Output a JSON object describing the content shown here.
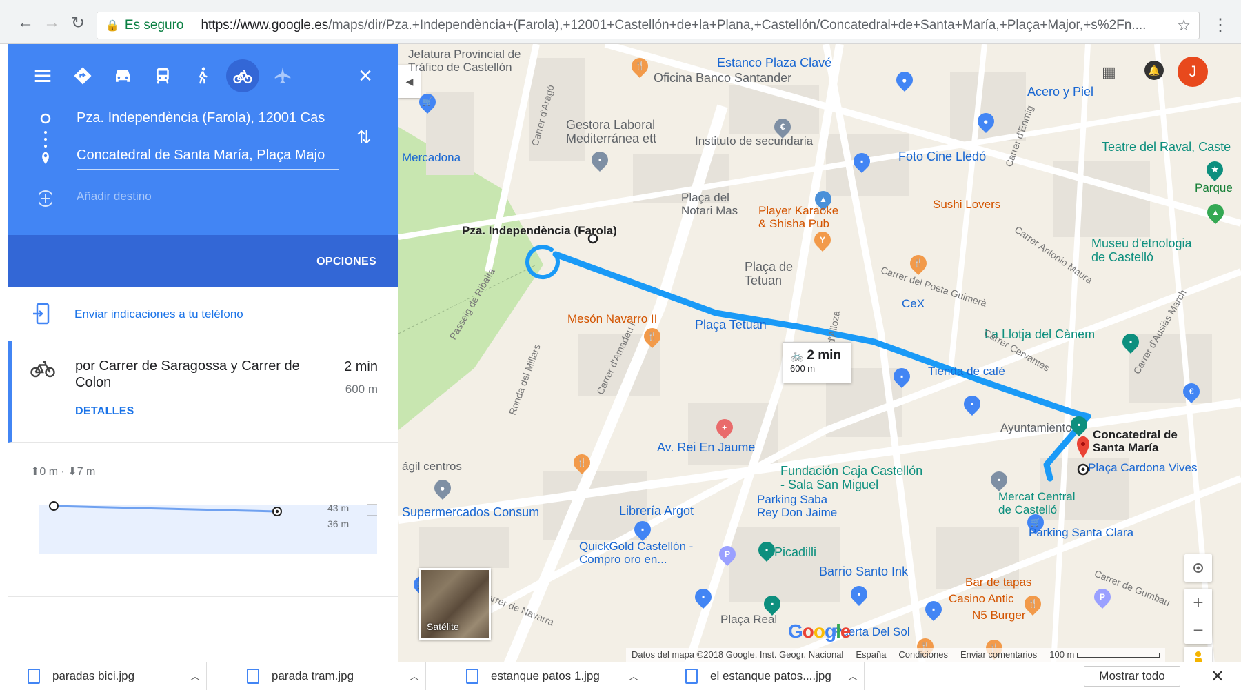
{
  "browser": {
    "secure_label": "Es seguro",
    "url_host": "https://www.google.es",
    "url_path": "/maps/dir/Pza.+Independència+(Farola),+12001+Castellón+de+la+Plana,+Castellón/Concatedral+de+Santa+María,+Plaça+Major,+s%2Fn...."
  },
  "directions": {
    "modes": [
      "menu",
      "best",
      "car",
      "transit",
      "walk",
      "bike",
      "flight"
    ],
    "active_mode": "bike",
    "origin": "Pza. Independència (Farola), 12001 Cas",
    "destination": "Concatedral de Santa María, Plaça Majo",
    "add_destination_placeholder": "Añadir destino",
    "options_label": "OPCIONES",
    "send_to_phone": "Enviar indicaciones a tu teléfono",
    "route": {
      "via": "por Carrer de Saragossa y Carrer de Colon",
      "time": "2 min",
      "distance": "600 m",
      "details_label": "DETALLES"
    },
    "elevation": {
      "summary": "⬆0 m · ⬇7 m",
      "max_label": "43 m",
      "min_label": "36 m"
    }
  },
  "map": {
    "avatar_letter": "J",
    "origin_label": "Pza. Independència (Farola)",
    "destination_label": "Concatedral de Santa María",
    "tooltip": {
      "time": "2 min",
      "distance": "600 m"
    },
    "satellite_label": "Satélite",
    "footer": {
      "attribution": "Datos del mapa ©2018 Google, Inst. Geogr. Nacional",
      "country": "España",
      "terms": "Condiciones",
      "feedback": "Enviar comentarios",
      "scale": "100 m"
    },
    "labels": [
      {
        "text": "Jefatura Provincial de Tráfico de Castellón",
        "display": "Jefatura Provincial de\nTráfico de Castellón",
        "cls": "poi-gray"
      },
      {
        "text": "Oficina Banco Santander",
        "cls": "poi-gray"
      },
      {
        "text": "Estanco Plaza Clavé",
        "cls": "poi-blue"
      },
      {
        "text": "Acero y Piel",
        "cls": "poi-blue"
      },
      {
        "text": "Gestora Laboral Mediterránea ett",
        "display": "Gestora Laboral\nMediterránea ett",
        "cls": "poi-gray"
      },
      {
        "text": "Instituto de secundaria",
        "cls": "poi-gray"
      },
      {
        "text": "Foto Cine Lledó",
        "cls": "poi-blue"
      },
      {
        "text": "Teatre del Raval, Caste",
        "cls": "poi-teal"
      },
      {
        "text": "Parque",
        "cls": "poi-green"
      },
      {
        "text": "Plaça del Notari Mas",
        "display": "Plaça del\nNotari Mas",
        "cls": "poi-gray"
      },
      {
        "text": "Player Karaoke & Shisha Pub",
        "display": "Player Karaoke\n& Shisha Pub",
        "cls": "poi-orange"
      },
      {
        "text": "Sushi Lovers",
        "cls": "poi-orange"
      },
      {
        "text": "Plaça de Tetuan",
        "display": "Plaça de\nTetuan",
        "cls": "poi-gray"
      },
      {
        "text": "Museu d'etnologia de Castelló",
        "display": "Museu d'etnologia\nde Castelló",
        "cls": "poi-teal"
      },
      {
        "text": "Mesón Navarro II",
        "cls": "poi-orange"
      },
      {
        "text": "Plaça Tetuan",
        "cls": "poi-blue"
      },
      {
        "text": "CeX",
        "cls": "poi-blue"
      },
      {
        "text": "La Llotja del Cànem",
        "cls": "poi-teal"
      },
      {
        "text": "Tienda de café",
        "cls": "poi-blue"
      },
      {
        "text": "Ayuntamiento",
        "cls": "poi-gray"
      },
      {
        "text": "Av. Rei En Jaume",
        "cls": "poi-blue"
      },
      {
        "text": "Fundación Caja Castellón - Sala San Miguel",
        "display": "Fundación Caja Castellón\n- Sala San Miguel",
        "cls": "poi-teal"
      },
      {
        "text": "Plaça Cardona Vives",
        "cls": "poi-blue"
      },
      {
        "text": "Mercat Central de Castelló",
        "display": "Mercat Central\nde Castelló",
        "cls": "poi-teal"
      },
      {
        "text": "Parking Santa Clara",
        "cls": "poi-blue"
      },
      {
        "text": "ágil centros",
        "cls": "poi-gray"
      },
      {
        "text": "Supermercados Consum",
        "cls": "poi-blue"
      },
      {
        "text": "Librería Argot",
        "cls": "poi-blue"
      },
      {
        "text": "Parking Saba Rey Don Jaime",
        "display": "Parking Saba\nRey Don Jaime",
        "cls": "poi-blue"
      },
      {
        "text": "QuickGold Castellón - Compro oro en...",
        "display": "QuickGold Castellón -\nCompro oro en...",
        "cls": "poi-blue"
      },
      {
        "text": "Picadilli",
        "cls": "poi-teal"
      },
      {
        "text": "Barrio Santo Ink",
        "cls": "poi-blue"
      },
      {
        "text": "Bar de tapas",
        "cls": "poi-orange"
      },
      {
        "text": "Casino Antic",
        "cls": "poi-orange"
      },
      {
        "text": "N5 Burger",
        "cls": "poi-orange"
      },
      {
        "text": "Plaça Real",
        "cls": "poi-gray"
      },
      {
        "text": "Puerta Del Sol",
        "cls": "poi-blue"
      },
      {
        "text": "Mercadona",
        "cls": "poi-blue"
      }
    ],
    "streets": [
      "Carrer d'Aragó",
      "Ronda del Millars",
      "Carrer d'Amadeu I",
      "Passeig de Ribalta",
      "Carrer del Poeta Guimerà",
      "Carrer de Navarra",
      "Carrer d'Alloza",
      "Carrer Antonio Maura",
      "Carrer Cervantes",
      "Carrer de Gumbau",
      "Carrer d'Enmig",
      "Carrer d'Ausiàs March"
    ]
  },
  "downloads": {
    "items": [
      "paradas bici.jpg",
      "parada tram.jpg",
      "estanque patos 1.jpg",
      "el estanque patos....jpg"
    ],
    "show_all": "Mostrar todo"
  },
  "colors": {
    "panel_blue": "#4285f4",
    "panel_dark_blue": "#3367d6",
    "route_blue": "#1a9af7",
    "avatar": "#e8491d"
  }
}
